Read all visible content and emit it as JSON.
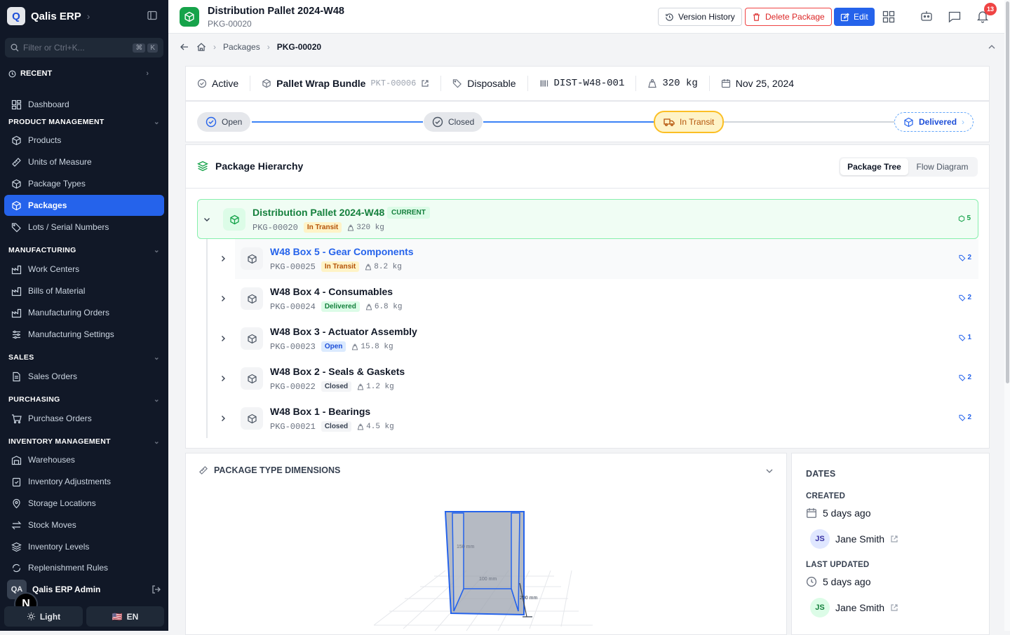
{
  "app": {
    "name": "Qalis ERP"
  },
  "sidebar": {
    "filter_placeholder": "Filter or Ctrl+K...",
    "kbd": [
      "⌘",
      "K"
    ],
    "recent": "RECENT",
    "dashboard": "Dashboard",
    "sections": [
      {
        "label": "PRODUCT MANAGEMENT",
        "items": [
          "Products",
          "Units of Measure",
          "Package Types",
          "Packages",
          "Lots / Serial Numbers"
        ]
      },
      {
        "label": "MANUFACTURING",
        "items": [
          "Work Centers",
          "Bills of Material",
          "Manufacturing Orders",
          "Manufacturing Settings"
        ]
      },
      {
        "label": "SALES",
        "items": [
          "Sales Orders"
        ]
      },
      {
        "label": "PURCHASING",
        "items": [
          "Purchase Orders"
        ]
      },
      {
        "label": "INVENTORY MANAGEMENT",
        "items": [
          "Warehouses",
          "Inventory Adjustments",
          "Storage Locations",
          "Stock Moves",
          "Inventory Levels",
          "Replenishment Rules"
        ]
      }
    ],
    "active_item": "Packages",
    "user": {
      "initials": "QA",
      "name": "Qalis ERP Admin"
    },
    "n_badge": "N",
    "theme_label": "Light",
    "lang_flag": "🇺🇸",
    "lang_label": "EN"
  },
  "header": {
    "title": "Distribution Pallet 2024-W48",
    "subtitle": "PKG-00020",
    "version_history": "Version History",
    "delete": "Delete Package",
    "edit": "Edit",
    "notifications": "13"
  },
  "breadcrumb": {
    "items": [
      "Packages",
      "PKG-00020"
    ]
  },
  "info": {
    "status": "Active",
    "package_type": "Pallet Wrap Bundle",
    "package_type_code": "PKT-00006",
    "usage": "Disposable",
    "barcode": "DIST-W48-001",
    "weight": "320 kg",
    "date": "Nov 25, 2024"
  },
  "timeline": {
    "steps": [
      "Open",
      "Closed",
      "In Transit",
      "Delivered"
    ],
    "current": "In Transit"
  },
  "hierarchy": {
    "title": "Package Hierarchy",
    "tabs": [
      "Package Tree",
      "Flow Diagram"
    ],
    "active_tab": "Package Tree",
    "root": {
      "name": "Distribution Pallet 2024-W48",
      "badge": "CURRENT",
      "code": "PKG-00020",
      "status": "In Transit",
      "weight": "320 kg",
      "count": "5"
    },
    "children": [
      {
        "name": "W48 Box 5 - Gear Components",
        "code": "PKG-00025",
        "status": "In Transit",
        "weight": "8.2 kg",
        "count": "2"
      },
      {
        "name": "W48 Box 4 - Consumables",
        "code": "PKG-00024",
        "status": "Delivered",
        "weight": "6.8 kg",
        "count": "2"
      },
      {
        "name": "W48 Box 3 - Actuator Assembly",
        "code": "PKG-00023",
        "status": "Open",
        "weight": "15.8 kg",
        "count": "1"
      },
      {
        "name": "W48 Box 2 - Seals & Gaskets",
        "code": "PKG-00022",
        "status": "Closed",
        "weight": "1.2 kg",
        "count": "2"
      },
      {
        "name": "W48 Box 1 - Bearings",
        "code": "PKG-00021",
        "status": "Closed",
        "weight": "4.5 kg",
        "count": "2"
      }
    ]
  },
  "dimensions": {
    "title": "PACKAGE TYPE DIMENSIONS",
    "labels": [
      "150 mm",
      "100 mm",
      "200 mm"
    ]
  },
  "dates": {
    "title": "DATES",
    "created_label": "CREATED",
    "created": "5 days ago",
    "created_by": "Jane Smith",
    "created_by_initials": "JS",
    "updated_label": "LAST UPDATED",
    "updated": "5 days ago",
    "updated_by": "Jane Smith",
    "updated_by_initials": "JS"
  }
}
